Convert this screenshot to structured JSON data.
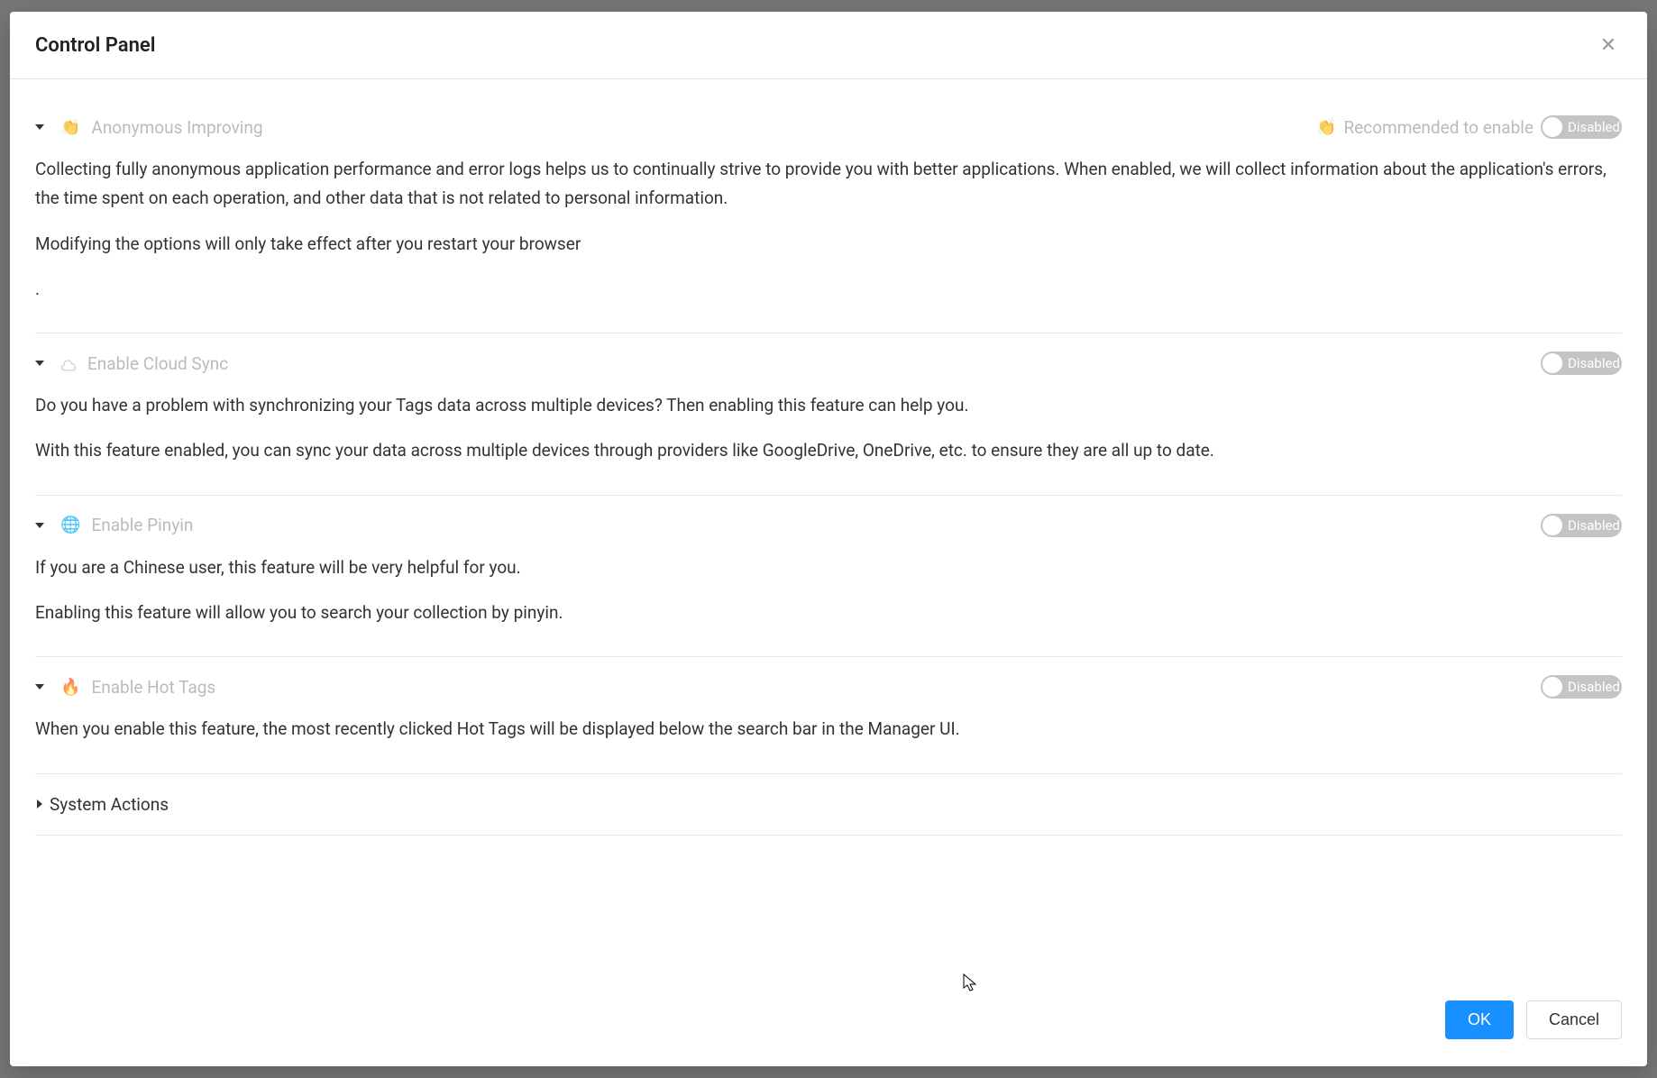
{
  "modal": {
    "title": "Control Panel",
    "ok_label": "OK",
    "cancel_label": "Cancel"
  },
  "sections": {
    "anonymous": {
      "title": "Anonymous Improving",
      "recommend": "Recommended to enable",
      "toggle": "Disabled",
      "p1": "Collecting fully anonymous application performance and error logs helps us to continually strive to provide you with better applications. When enabled, we will collect information about the application's errors, the time spent on each operation, and other data that is not related to personal information.",
      "p2": "Modifying the options will only take effect after you restart your browser",
      "p3": "."
    },
    "cloudSync": {
      "title": "Enable Cloud Sync",
      "toggle": "Disabled",
      "p1": "Do you have a problem with synchronizing your Tags data across multiple devices? Then enabling this feature can help you.",
      "p2": "With this feature enabled, you can sync your data across multiple devices through providers like GoogleDrive, OneDrive, etc. to ensure they are all up to date."
    },
    "pinyin": {
      "title": "Enable Pinyin",
      "toggle": "Disabled",
      "p1": "If you are a Chinese user, this feature will be very helpful for you.",
      "p2": "Enabling this feature will allow you to search your collection by pinyin."
    },
    "hotTags": {
      "title": "Enable Hot Tags",
      "toggle": "Disabled",
      "p1": "When you enable this feature, the most recently clicked Hot Tags will be displayed below the search bar in the Manager UI."
    },
    "systemActions": {
      "title": "System Actions"
    }
  }
}
